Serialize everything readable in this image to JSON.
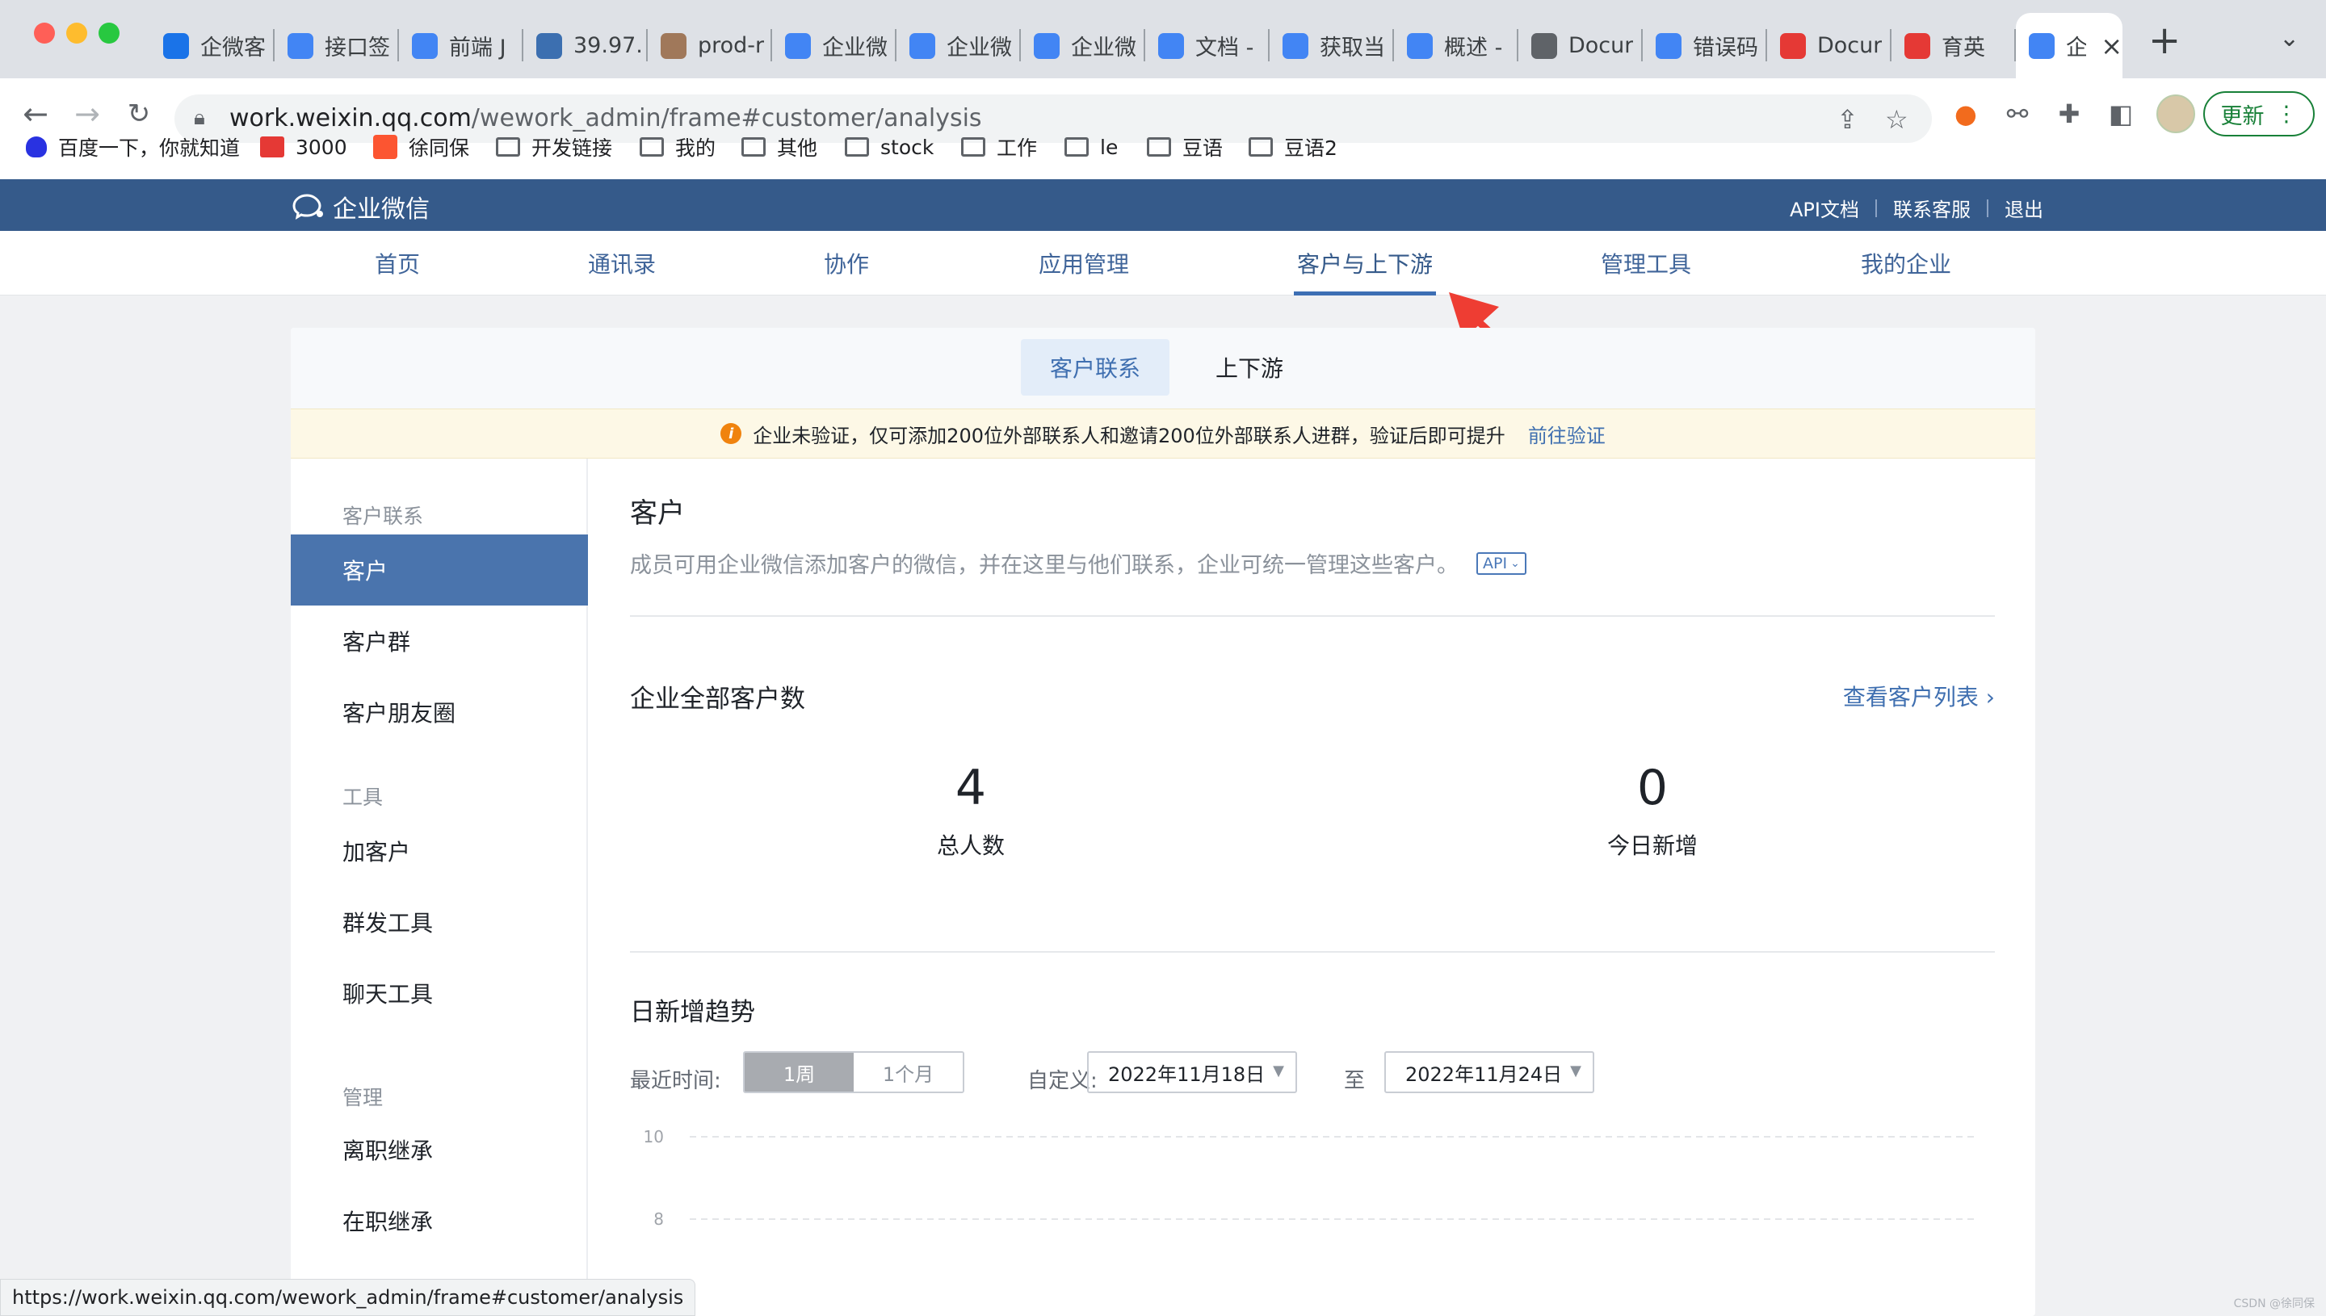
{
  "browser": {
    "tabs": [
      {
        "title": "企微客",
        "color": "#1a73e8"
      },
      {
        "title": "接口签",
        "color": "#4285f4"
      },
      {
        "title": "前端 J",
        "color": "#4285f4"
      },
      {
        "title": "39.97.",
        "color": "#3c6fb0"
      },
      {
        "title": "prod-r",
        "color": "#a0785a"
      },
      {
        "title": "企业微",
        "color": "#4285f4"
      },
      {
        "title": "企业微",
        "color": "#4285f4"
      },
      {
        "title": "企业微",
        "color": "#4285f4"
      },
      {
        "title": "文档 -",
        "color": "#4285f4"
      },
      {
        "title": "获取当",
        "color": "#4285f4"
      },
      {
        "title": "概述 -",
        "color": "#4285f4"
      },
      {
        "title": "Docur",
        "color": "#5f6368"
      },
      {
        "title": "错误码",
        "color": "#4285f4"
      },
      {
        "title": "Docur",
        "color": "#e53935"
      },
      {
        "title": "育英",
        "color": "#e53935"
      },
      {
        "title": "企",
        "color": "#4285f4",
        "active": true
      }
    ],
    "url_host": "work.weixin.qq.com",
    "url_path": "/wework_admin/frame#customer/analysis",
    "update_label": "更新",
    "bookmarks": [
      {
        "label": "百度一下，你就知道",
        "icon": "baidu-icon"
      },
      {
        "label": "3000",
        "icon": "book-icon"
      },
      {
        "label": "徐同保",
        "icon": "csdn-icon"
      },
      {
        "label": "开发链接",
        "icon": "folder-icon"
      },
      {
        "label": "我的",
        "icon": "folder-icon"
      },
      {
        "label": "其他",
        "icon": "folder-icon"
      },
      {
        "label": "stock",
        "icon": "folder-icon"
      },
      {
        "label": "工作",
        "icon": "folder-icon"
      },
      {
        "label": "le",
        "icon": "folder-icon"
      },
      {
        "label": "豆语",
        "icon": "folder-icon"
      },
      {
        "label": "豆语2",
        "icon": "folder-icon"
      }
    ],
    "status_url": "https://work.weixin.qq.com/wework_admin/frame#customer/analysis"
  },
  "header": {
    "logo": "企业微信",
    "links": [
      "API文档",
      "联系客服",
      "退出"
    ]
  },
  "nav": {
    "items": [
      "首页",
      "通讯录",
      "协作",
      "应用管理",
      "客户与上下游",
      "管理工具",
      "我的企业"
    ],
    "active": "客户与上下游"
  },
  "subtabs": [
    "客户联系",
    "上下游"
  ],
  "notice": {
    "text": "企业未验证，仅可添加200位外部联系人和邀请200位外部联系人进群，验证后即可提升",
    "link": "前往验证"
  },
  "sidebar": {
    "groups": [
      {
        "title": "客户联系",
        "items": [
          "客户",
          "客户群",
          "客户朋友圈"
        ]
      },
      {
        "title": "工具",
        "items": [
          "加客户",
          "群发工具",
          "聊天工具"
        ]
      },
      {
        "title": "管理",
        "items": [
          "离职继承",
          "在职继承"
        ]
      }
    ],
    "active": "客户"
  },
  "content": {
    "title": "客户",
    "description": "成员可用企业微信添加客户的微信，并在这里与他们联系，企业可统一管理这些客户。",
    "api_tag": "API",
    "stats_title": "企业全部客户数",
    "view_list": "查看客户列表",
    "stats": [
      {
        "value": "4",
        "label": "总人数"
      },
      {
        "value": "0",
        "label": "今日新增"
      }
    ],
    "trend_title": "日新增趋势",
    "range_label": "最近时间:",
    "ranges": [
      "1周",
      "1个月"
    ],
    "active_range": "1周",
    "custom_label": "自定义:",
    "start_date": "2022年11月18日",
    "to_label": "至",
    "end_date": "2022年11月24日"
  },
  "chart_data": {
    "type": "line",
    "y_ticks": [
      10,
      8
    ],
    "series": []
  },
  "watermark": "CSDN @徐同保",
  "colors": {
    "brand": "#355a8a",
    "accent": "#3f6fb0",
    "sidebar_active": "#4a74ad",
    "annotation": "#ee3d33"
  }
}
